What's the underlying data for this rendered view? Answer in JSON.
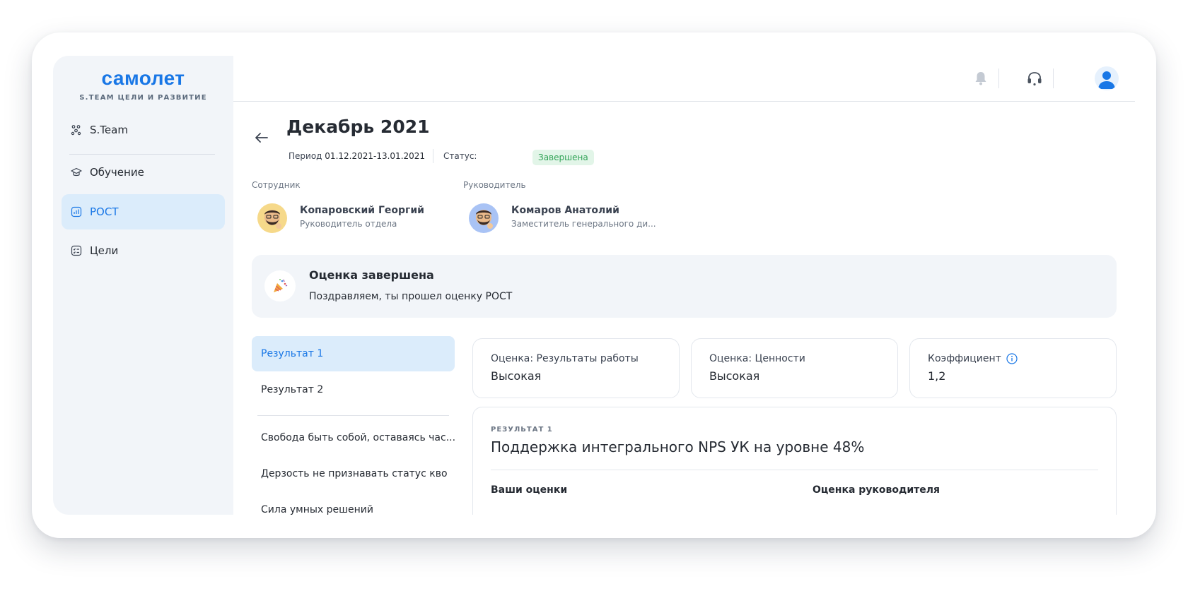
{
  "app": {
    "logo": "самолет",
    "logo_sub": "S.TEAM ЦЕЛИ И РАЗВИТИЕ"
  },
  "sidebar": {
    "items": [
      {
        "label": "S.Team",
        "icon": "team-icon"
      },
      {
        "label": "Обучение",
        "icon": "graduation-cap-icon"
      },
      {
        "label": "РОСТ",
        "icon": "chart-icon",
        "active": true
      },
      {
        "label": "Цели",
        "icon": "goals-icon"
      }
    ]
  },
  "header": {
    "icons": [
      "bell-icon",
      "headset-icon",
      "user-avatar"
    ]
  },
  "page": {
    "title": "Декабрь 2021",
    "period_label": "Период",
    "period_value": "01.12.2021-13.01.2021",
    "status_label": "Статус:",
    "status_value": "Завершена",
    "employee_caption": "Сотрудник",
    "employee_name": "Копаровский Георгий",
    "employee_role": "Руководитель отдела",
    "manager_caption": "Руководитель",
    "manager_name": "Комаров Анатолий",
    "manager_role": "Заместитель генерального ди..."
  },
  "banner": {
    "title": "Оценка завершена",
    "text": "Поздравляем, ты прошел оценку РОСТ",
    "icon": "party-popper-icon"
  },
  "results_list": {
    "items": [
      {
        "label": "Результат 1",
        "active": true
      },
      {
        "label": "Результат 2"
      },
      {
        "label": "Свобода быть собой, оставаясь час..."
      },
      {
        "label": "Дерзость не признавать статус кво"
      },
      {
        "label": "Сила умных решений"
      }
    ]
  },
  "cards": [
    {
      "label": "Оценка: Результаты работы",
      "value": "Высокая"
    },
    {
      "label": "Оценка: Ценности",
      "value": "Высокая"
    },
    {
      "label": "Коэффициент",
      "value": "1,2"
    }
  ],
  "detail": {
    "kicker": "РЕЗУЛЬТАТ 1",
    "title": "Поддержка интегрального NPS УК на уровне 48%",
    "col_left": "Ваши оценки",
    "col_right": "Оценка руководителя"
  },
  "colors": {
    "accent": "#1977e6",
    "active_bg": "#dbecfb",
    "sidebar_bg": "#f2f5f9",
    "status_bg": "#e2f5e8",
    "status_text": "#31a356"
  }
}
